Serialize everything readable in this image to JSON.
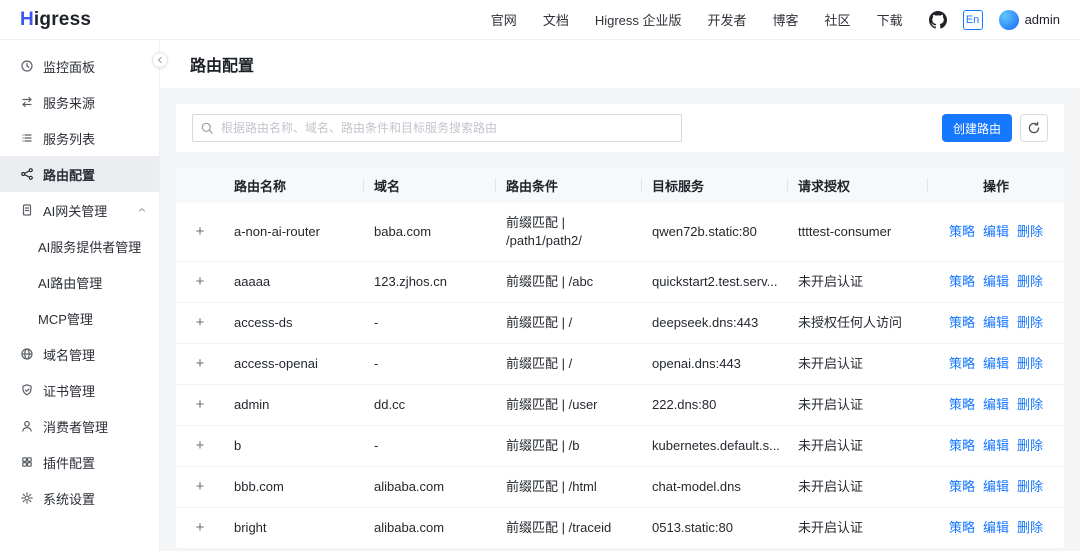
{
  "topbar": {
    "logo_h": "H",
    "logo_rest": "igress",
    "nav": [
      "官网",
      "文档",
      "Higress 企业版",
      "开发者",
      "博客",
      "社区",
      "下载"
    ],
    "lang_badge": "En",
    "username": "admin"
  },
  "sidebar": {
    "items": [
      "监控面板",
      "服务来源",
      "服务列表",
      "路由配置",
      "AI网关管理",
      "域名管理",
      "证书管理",
      "消费者管理",
      "插件配置",
      "系统设置"
    ],
    "ai_children": [
      "AI服务提供者管理",
      "AI路由管理",
      "MCP管理"
    ]
  },
  "page": {
    "title": "路由配置"
  },
  "toolbar": {
    "search_placeholder": "根据路由名称、域名、路由条件和目标服务搜索路由",
    "create_button": "创建路由"
  },
  "table": {
    "expand_symbol": "+",
    "headers": {
      "name": "路由名称",
      "domain": "域名",
      "condition": "路由条件",
      "service": "目标服务",
      "auth": "请求授权",
      "actions": "操作"
    },
    "action_labels": [
      "策略",
      "编辑",
      "删除"
    ],
    "rows": [
      {
        "name": "a-non-ai-router",
        "domain": "baba.com",
        "condition": "前缀匹配 | /path1/path2/",
        "service": "qwen72b.static:80",
        "auth": "ttttest-consumer"
      },
      {
        "name": "aaaaa",
        "domain": "123.zjhos.cn",
        "condition": "前缀匹配 | /abc",
        "service": "quickstart2.test.serv...",
        "auth": "未开启认证"
      },
      {
        "name": "access-ds",
        "domain": "-",
        "condition": "前缀匹配 | /",
        "service": "deepseek.dns:443",
        "auth": "未授权任何人访问"
      },
      {
        "name": "access-openai",
        "domain": "-",
        "condition": "前缀匹配 | /",
        "service": "openai.dns:443",
        "auth": "未开启认证"
      },
      {
        "name": "admin",
        "domain": "dd.cc",
        "condition": "前缀匹配 | /user",
        "service": "222.dns:80",
        "auth": "未开启认证"
      },
      {
        "name": "b",
        "domain": "-",
        "condition": "前缀匹配 | /b",
        "service": "kubernetes.default.s...",
        "auth": "未开启认证"
      },
      {
        "name": "bbb.com",
        "domain": "alibaba.com",
        "condition": "前缀匹配 | /html",
        "service": "chat-model.dns",
        "auth": "未开启认证"
      },
      {
        "name": "bright",
        "domain": "alibaba.com",
        "condition": "前缀匹配 | /traceid",
        "service": "0513.static:80",
        "auth": "未开启认证"
      }
    ]
  },
  "colors": {
    "accent": "#1677ff",
    "link": "#1677ff"
  }
}
